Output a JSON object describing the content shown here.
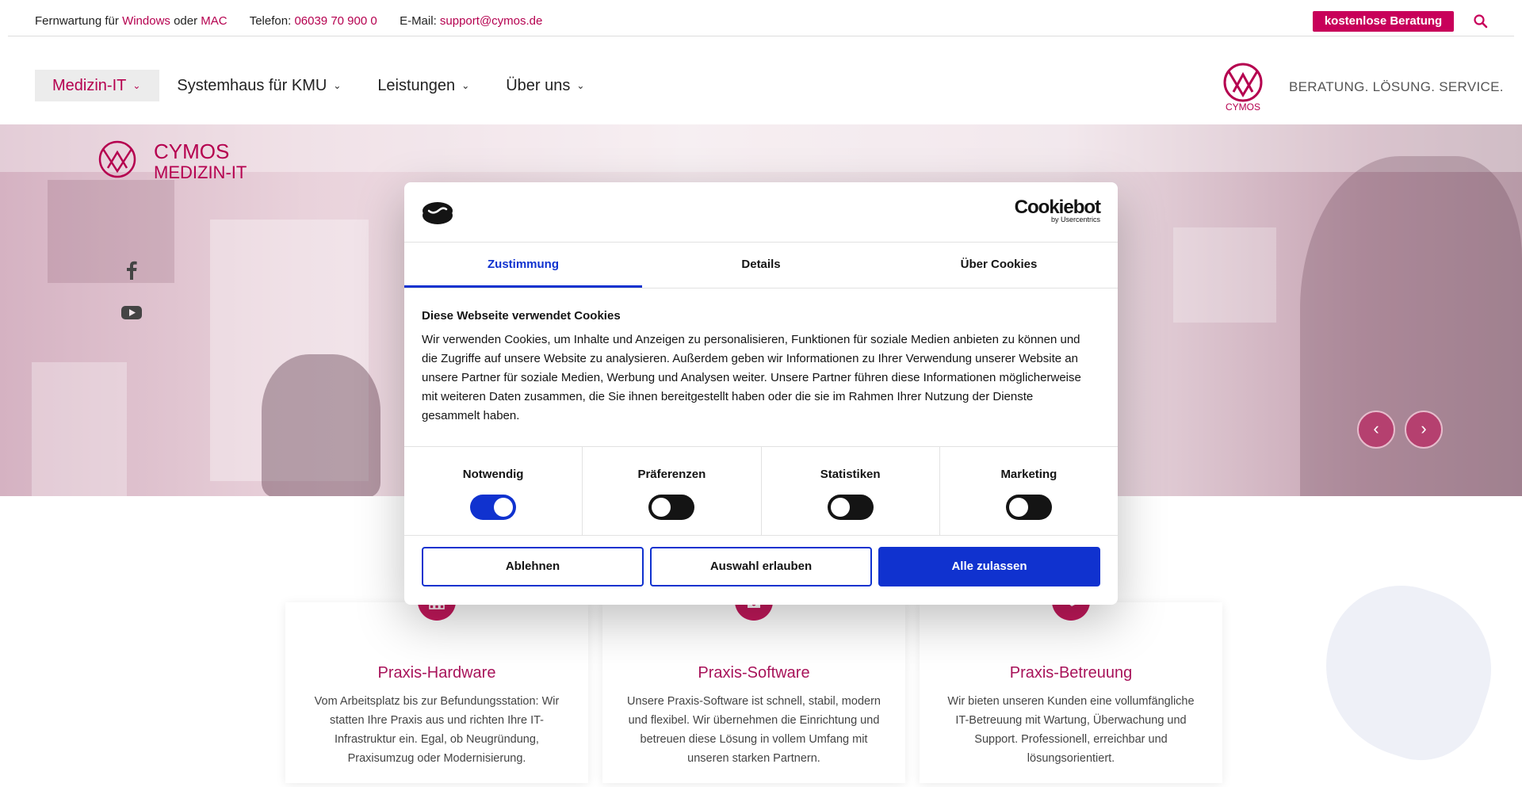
{
  "topbar": {
    "remote_prefix": "Fernwartung für",
    "remote_windows": "Windows",
    "remote_or": "oder",
    "remote_mac": "MAC",
    "phone_label": "Telefon:",
    "phone_value": "06039 70 900 0",
    "email_label": "E-Mail:",
    "email_value": "support@cymos.de",
    "cta_label": "kostenlose Beratung",
    "search_icon": "search-icon"
  },
  "nav": {
    "items": [
      {
        "label": "Medizin-IT",
        "active": true
      },
      {
        "label": "Systemhaus für KMU",
        "active": false
      },
      {
        "label": "Leistungen",
        "active": false
      },
      {
        "label": "Über uns",
        "active": false
      }
    ],
    "brand_name": "CYMOS",
    "slogan": "BERATUNG. LÖSUNG. SERVICE."
  },
  "hero": {
    "logo_line1": "CYMOS",
    "logo_line2": "MEDIZIN-IT",
    "social": [
      "facebook-icon",
      "youtube-icon"
    ],
    "prev_label": "‹",
    "next_label": "›"
  },
  "cookie": {
    "brand": "Cookiebot",
    "brand_sub": "by Usercentrics",
    "tabs": [
      "Zustimmung",
      "Details",
      "Über Cookies"
    ],
    "active_tab": "Zustimmung",
    "title": "Diese Webseite verwendet Cookies",
    "text": "Wir verwenden Cookies, um Inhalte und Anzeigen zu personalisieren, Funktionen für soziale Medien anbieten zu können und die Zugriffe auf unsere Website zu analysieren. Außerdem geben wir Informationen zu Ihrer Verwendung unserer Website an unsere Partner für soziale Medien, Werbung und Analysen weiter. Unsere Partner führen diese Informationen möglicherweise mit weiteren Daten zusammen, die Sie ihnen bereitgestellt haben oder die sie im Rahmen Ihrer Nutzung der Dienste gesammelt haben.",
    "categories": [
      {
        "label": "Notwendig",
        "on": true
      },
      {
        "label": "Präferenzen",
        "on": false
      },
      {
        "label": "Statistiken",
        "on": false
      },
      {
        "label": "Marketing",
        "on": false
      }
    ],
    "buttons": {
      "reject": "Ablehnen",
      "allow_selection": "Auswahl erlauben",
      "allow_all": "Alle zulassen"
    }
  },
  "cards": [
    {
      "title": "Praxis-Hardware",
      "icon": "network-icon",
      "text": "Vom Arbeitsplatz bis zur Befundungsstation: Wir statten Ihre Praxis aus und richten Ihre IT-Infrastruktur ein. Egal, ob Neugründung, Praxisumzug oder Modernisierung."
    },
    {
      "title": "Praxis-Software",
      "icon": "floppy-disk-icon",
      "text": "Unsere Praxis-Software ist schnell, stabil, modern und flexibel. Wir übernehmen die Einrichtung und betreuen diese Lösung in vollem Umfang mit unseren starken Partnern."
    },
    {
      "title": "Praxis-Betreuung",
      "icon": "handshake-icon",
      "text": "Wir bieten unseren Kunden eine vollumfängliche IT-Betreuung mit Wartung, Überwachung und Support. Professionell, erreichbar und lösungsorientiert."
    }
  ],
  "colors": {
    "brand": "#c8005a",
    "cookie_accent": "#1032cf"
  }
}
